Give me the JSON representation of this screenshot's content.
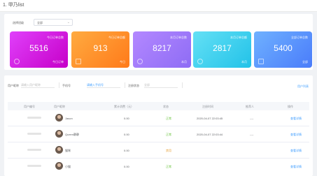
{
  "header": {
    "title": "1. 甲乃list"
  },
  "filter": {
    "label": "选择班级",
    "select_value": "全部"
  },
  "cards": [
    {
      "label": "今日订单总数",
      "value": "5516",
      "sub": "今日订单",
      "color_from": "#e040fb",
      "color_to": "#c600c8",
      "icon": "eye-icon"
    },
    {
      "label": "今日订单总额",
      "value": "913",
      "sub": "今日",
      "color_from": "#ffab40",
      "color_to": "#ff7a1a",
      "icon": "document-icon"
    },
    {
      "label": "本月订单总数",
      "value": "8217",
      "sub": "本月",
      "color_from": "#b388ff",
      "color_to": "#8e6cf5",
      "icon": "yen-icon"
    },
    {
      "label": "本月订单总额",
      "value": "2817",
      "sub": "本月",
      "color_from": "#64e0f5",
      "color_to": "#22c2e8",
      "icon": "yen-circle-icon"
    },
    {
      "label": "全部订单总数",
      "value": "5400",
      "sub": "全部",
      "color_from": "#6fb1ff",
      "color_to": "#4a7cfa",
      "icon": "calendar-icon"
    }
  ],
  "toolbar": {
    "name_label": "用户昵称",
    "name_placeholder": "请输入用户昵称",
    "phone_label": "手机号",
    "phone_value": "请输入手机号",
    "status_label": "注册状态",
    "status_value": "全部",
    "link": "用户列表"
  },
  "table": {
    "headers": [
      "用户编号",
      "用户昵称",
      "累计消费（元）",
      "状态",
      "注册时间",
      "推荐人",
      "操作"
    ],
    "rows": [
      {
        "name": "Jason",
        "amount": "0.00",
        "status": "正常",
        "status_color": "green",
        "time": "2020-04-07 22:03:45",
        "referrer": "----",
        "action": "查看详情"
      },
      {
        "name": "Queen静静",
        "amount": "0.00",
        "status": "正常",
        "status_color": "green",
        "time": "2020-04-07 22:03:44",
        "referrer": "----",
        "action": "查看详情"
      },
      {
        "name": "猫咪",
        "amount": "0.00",
        "status": "禁用",
        "status_color": "orange",
        "time": "",
        "referrer": "",
        "action": "查看详情"
      },
      {
        "name": "小猫",
        "amount": "0.00",
        "status": "正常",
        "status_color": "green",
        "time": "",
        "referrer": "",
        "action": "查看详情"
      }
    ]
  }
}
